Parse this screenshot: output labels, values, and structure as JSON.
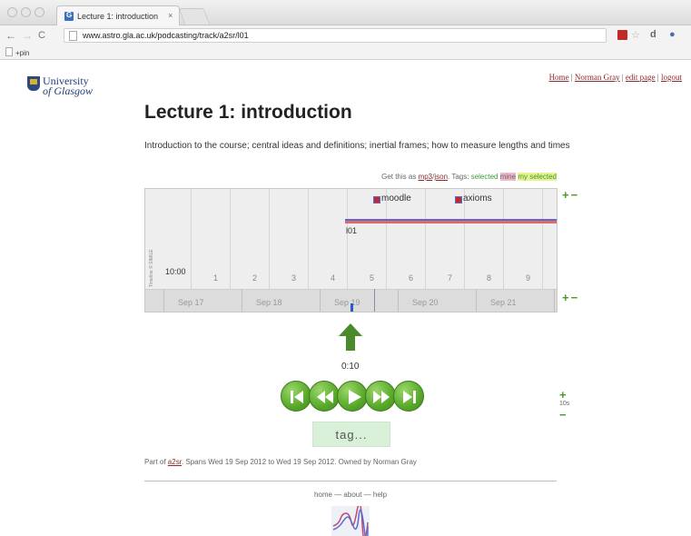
{
  "browser": {
    "tab_title": "Lecture 1: introduction",
    "tab_close": "×",
    "url": "www.astro.gla.ac.uk/podcasting/track/a2sr/l01",
    "bookmark": "+pin"
  },
  "logo": {
    "line1": "University",
    "line2": "of Glasgow"
  },
  "toplinks": {
    "home": "Home",
    "user": "Norman Gray",
    "edit": "edit page",
    "logout": "logout",
    "sep": " | "
  },
  "page": {
    "title": "Lecture 1: introduction",
    "description": "Introduction to the course; central ideas and definitions; inertial frames; how to measure lengths and times",
    "get_prefix": "Get this as ",
    "get_mp3": "mp3",
    "get_slash": "/",
    "get_json": "json",
    "tags_prefix": ". Tags: ",
    "tag_selected": "selected",
    "tag_mine": "mine",
    "tag_myselected": "my selected"
  },
  "timeline": {
    "time_label": "10:00",
    "credit": "Timeline © SIMILE",
    "hour_ticks": [
      "1",
      "2",
      "3",
      "4",
      "5",
      "6",
      "7",
      "8",
      "9"
    ],
    "days": [
      "Sep 17",
      "Sep 18",
      "Sep 19",
      "Sep 20",
      "Sep 21"
    ],
    "track_label": "l01",
    "tags": [
      "moodle",
      "axioms"
    ],
    "zoom_plus": "+",
    "zoom_minus": "−"
  },
  "player": {
    "elapsed": "0:10",
    "skip_label": "10s",
    "plus": "+",
    "minus": "−",
    "tag_button": "tag..."
  },
  "footer": {
    "part_of_prefix": "Part of ",
    "part_of_link": "a2sr",
    "part_of_suffix": ". Spans Wed 19 Sep 2012 to Wed 19 Sep 2012. Owned by Norman Gray",
    "links": "home — about — help"
  },
  "colors": {
    "accent_green": "#4a9a2a",
    "link_red": "#8a2a2a",
    "track_blue": "#5a6ad0",
    "track_red": "#e06a6a"
  }
}
